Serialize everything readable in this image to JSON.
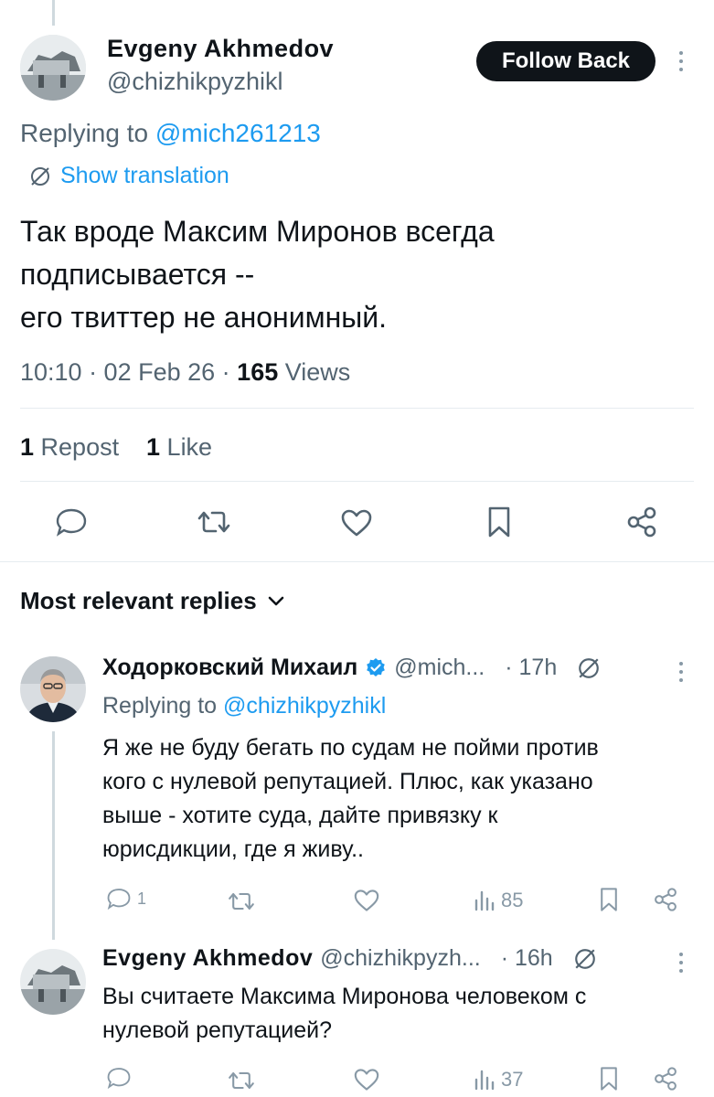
{
  "main_tweet": {
    "author_name": "Evgeny Akhmedov",
    "author_handle": "@chizhikpyzhikl",
    "follow_label": "Follow Back",
    "replying_prefix": "Replying to",
    "replying_handle": "@mich261213",
    "translate_label": "Show translation",
    "text_line1": "Так вроде Максим Миронов всегда",
    "text_line2": "подписывается --",
    "text_line3": "его твиттер не анонимный.",
    "time": "10:10 · 02 Feb 26 ·",
    "views_count": "165",
    "views_label": "Views",
    "reposts_count": "1",
    "reposts_label": "Repost",
    "likes_count": "1",
    "likes_label": "Like"
  },
  "replies_header": {
    "label": "Most relevant replies"
  },
  "replies": [
    {
      "author_name": "Ходорковский Михаил",
      "author_handle": "@mich...",
      "time": "· 17h",
      "replying_prefix": "Replying to",
      "replying_handle": "@chizhikpyzhikl",
      "text_line1": "Я же не буду бегать по судам не пойми против",
      "text_line2": "кого с нулевой репутацией. Плюс, как указано",
      "text_line3": "выше -  хотите суда, дайте привязку к",
      "text_line4": "юрисдикции, где я живу..",
      "reply_count": "1",
      "views": "85"
    },
    {
      "author_name": "Evgeny Akhmedov",
      "author_handle": "@chizhikpyzh...",
      "time": "· 16h",
      "text_line1": "Вы считаете Максима Миронова человеком с",
      "text_line2": "нулевой репутацией?",
      "views": "37"
    }
  ],
  "colors": {
    "accent": "#1d9bf0",
    "text": "#0f1419",
    "muted": "#536471",
    "divider": "#e6ecf0",
    "verified": "#1d9bf0"
  }
}
